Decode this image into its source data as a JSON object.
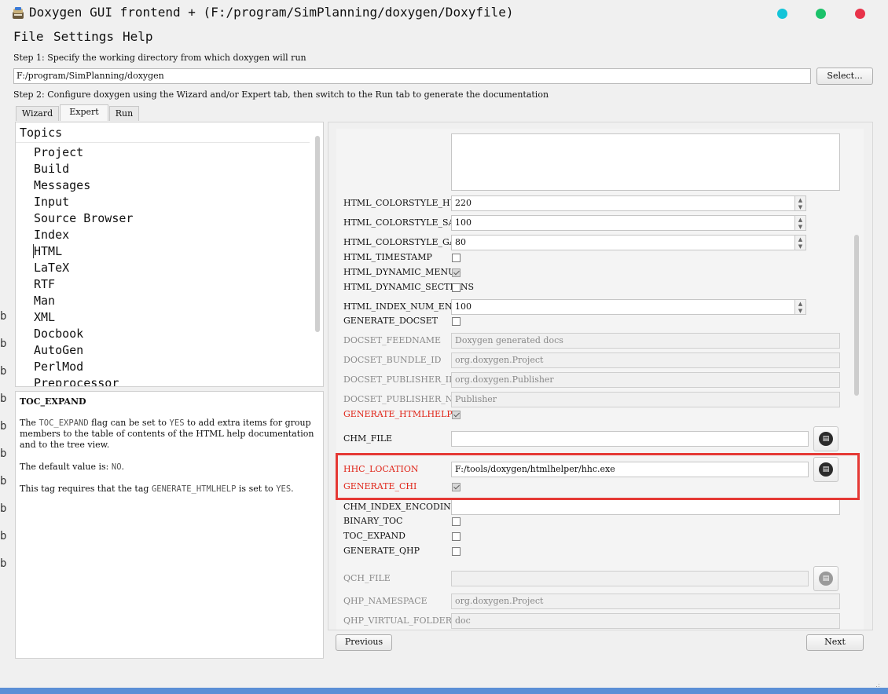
{
  "window": {
    "title": "Doxygen GUI frontend + (F:/program/SimPlanning/doxygen/Doxyfile)",
    "controls": [
      {
        "name": "minimize",
        "color": "#14c4d8"
      },
      {
        "name": "maximize",
        "color": "#1bc26a"
      },
      {
        "name": "close",
        "color": "#e8334a"
      }
    ]
  },
  "menu": {
    "file": "File",
    "settings": "Settings",
    "help": "Help"
  },
  "step1": {
    "label": "Step 1: Specify the working directory from which doxygen will run",
    "workdir": "F:/program/SimPlanning/doxygen",
    "select_label": "Select..."
  },
  "step2": {
    "label": "Step 2: Configure doxygen using the Wizard and/or Expert tab, then switch to the Run tab to generate the documentation"
  },
  "tabs": [
    {
      "label": "Wizard",
      "active": false
    },
    {
      "label": "Expert",
      "active": true
    },
    {
      "label": "Run",
      "active": false
    }
  ],
  "topics": {
    "header": "Topics",
    "items": [
      "Project",
      "Build",
      "Messages",
      "Input",
      "Source Browser",
      "Index",
      "HTML",
      "LaTeX",
      "RTF",
      "Man",
      "XML",
      "Docbook",
      "AutoGen",
      "PerlMod",
      "Preprocessor"
    ],
    "selected": "HTML"
  },
  "help": {
    "title": "TOC_EXPAND",
    "p1_a": "The ",
    "p1_code1": "TOC_EXPAND",
    "p1_b": " flag can be set to ",
    "p1_code2": "YES",
    "p1_c": " to add extra items for group members to the table of contents of the HTML help documentation and to the tree view.",
    "p2_a": "The default value is: ",
    "p2_code": "NO",
    "p2_b": ".",
    "p3_a": "This tag requires that the tag ",
    "p3_code1": "GENERATE_HTMLHELP",
    "p3_b": " is set to ",
    "p3_code2": "YES",
    "p3_c": "."
  },
  "settings": [
    {
      "key": "HTML_COLORSTYLE_HUE",
      "type": "spin",
      "value": "220"
    },
    {
      "key": "HTML_COLORSTYLE_SAT",
      "type": "spin",
      "value": "100"
    },
    {
      "key": "HTML_COLORSTYLE_GAMMA",
      "type": "spin",
      "value": "80"
    },
    {
      "key": "HTML_TIMESTAMP",
      "type": "check",
      "checked": false
    },
    {
      "key": "HTML_DYNAMIC_MENUS",
      "type": "check",
      "checked": true
    },
    {
      "key": "HTML_DYNAMIC_SECTIONS",
      "type": "check",
      "checked": false
    },
    {
      "key": "HTML_INDEX_NUM_ENTRIES",
      "type": "spin",
      "value": "100"
    },
    {
      "key": "GENERATE_DOCSET",
      "type": "check",
      "checked": false
    },
    {
      "key": "DOCSET_FEEDNAME",
      "type": "text",
      "value": "Doxygen generated docs",
      "disabled": true
    },
    {
      "key": "DOCSET_BUNDLE_ID",
      "type": "text",
      "value": "org.doxygen.Project",
      "disabled": true
    },
    {
      "key": "DOCSET_PUBLISHER_ID",
      "type": "text",
      "value": "org.doxygen.Publisher",
      "disabled": true
    },
    {
      "key": "DOCSET_PUBLISHER_NAME",
      "type": "text",
      "value": "Publisher",
      "disabled": true
    },
    {
      "key": "GENERATE_HTMLHELP",
      "type": "check",
      "checked": true,
      "modified": true
    },
    {
      "key": "CHM_FILE",
      "type": "file",
      "value": ""
    },
    {
      "key": "HHC_LOCATION",
      "type": "file",
      "value": "F:/tools/doxygen/htmlhelper/hhc.exe",
      "modified": true
    },
    {
      "key": "GENERATE_CHI",
      "type": "check",
      "checked": true,
      "modified": true
    },
    {
      "key": "CHM_INDEX_ENCODING",
      "type": "text",
      "value": ""
    },
    {
      "key": "BINARY_TOC",
      "type": "check",
      "checked": false
    },
    {
      "key": "TOC_EXPAND",
      "type": "check",
      "checked": false
    },
    {
      "key": "GENERATE_QHP",
      "type": "check",
      "checked": false
    },
    {
      "key": "QCH_FILE",
      "type": "file",
      "value": "",
      "disabled": true
    },
    {
      "key": "QHP_NAMESPACE",
      "type": "text",
      "value": "org.doxygen.Project",
      "disabled": true
    },
    {
      "key": "QHP_VIRTUAL_FOLDER",
      "type": "text",
      "value": "doc",
      "disabled": true
    }
  ],
  "nav": {
    "previous": "Previous",
    "next": "Next"
  },
  "colors": {
    "modified_label": "#e0261a",
    "highlight_box": "#e53935"
  },
  "background_glyphs": [
    "b",
    "b",
    "b",
    "b",
    "b",
    "b",
    "b",
    "b",
    "b",
    "b"
  ]
}
